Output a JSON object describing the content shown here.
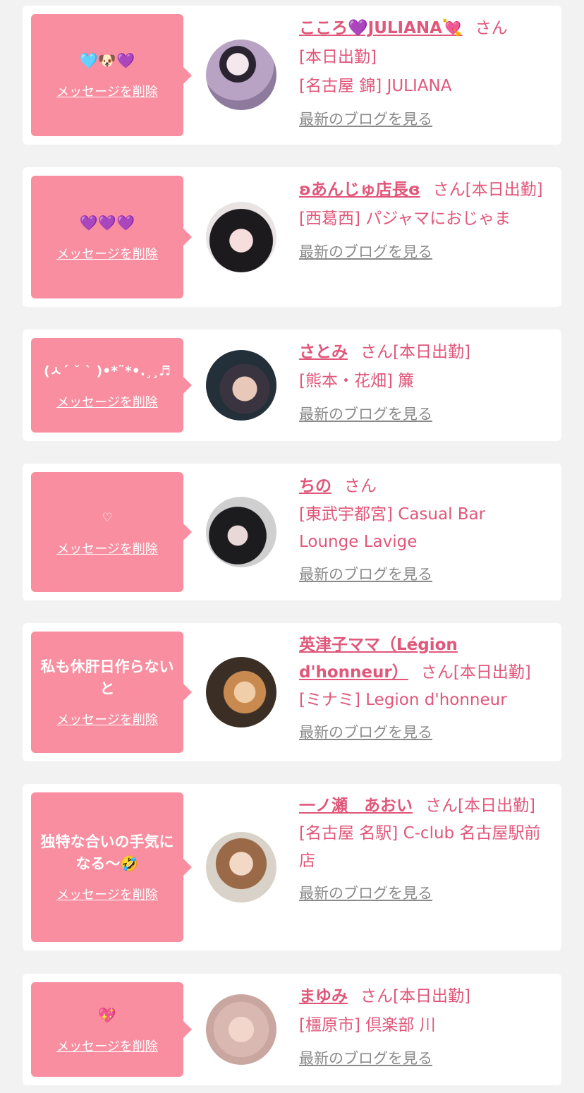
{
  "suffix": "さん",
  "delete_label": "メッセージを削除",
  "blog_label": "最新のブログを見る",
  "colors": {
    "background": "#f2f2f2",
    "bubble": "#f88ea0",
    "accent_text": "#e0577a",
    "muted_link": "#8a8a8a"
  },
  "items": [
    {
      "message": "🩵🐶💜",
      "name": "こころ💜JULIANA💘",
      "shift": "",
      "shop": "[名古屋 錦] JULIANA",
      "shift_line": "[本日出勤]"
    },
    {
      "message": "💜💜💜",
      "name": "ʚあんじゅ店長ɞ",
      "shift": "[本日出勤]",
      "shop": "[西葛西] パジャマにおじゃま",
      "shift_line": ""
    },
    {
      "message": "(ㅅ´ ˘ ` )•*¨*•.¸¸♬",
      "name": "さとみ",
      "shift": "[本日出勤]",
      "shop": "[熊本・花畑] 簾",
      "shift_line": ""
    },
    {
      "message": "♡",
      "name": "ちの",
      "shift": "",
      "shop": "[東武宇都宮] Casual Bar Lounge Lavige",
      "shift_line": ""
    },
    {
      "message": "私も休肝日作らないと",
      "name": "英津子ママ（Légion d'honneur）",
      "shift": "[本日出勤]",
      "shop": "[ミナミ] Legion d'honneur",
      "shift_line": ""
    },
    {
      "message": "独特な合いの手気になる〜🤣",
      "name": "一ノ瀬　あおい",
      "shift": "[本日出勤]",
      "shop": "[名古屋 名駅] C-club 名古屋駅前店",
      "shift_line": ""
    },
    {
      "message": "💖",
      "name": "まゆみ",
      "shift": "[本日出勤]",
      "shop": "[橿原市] 倶楽部 川",
      "shift_line": ""
    }
  ]
}
